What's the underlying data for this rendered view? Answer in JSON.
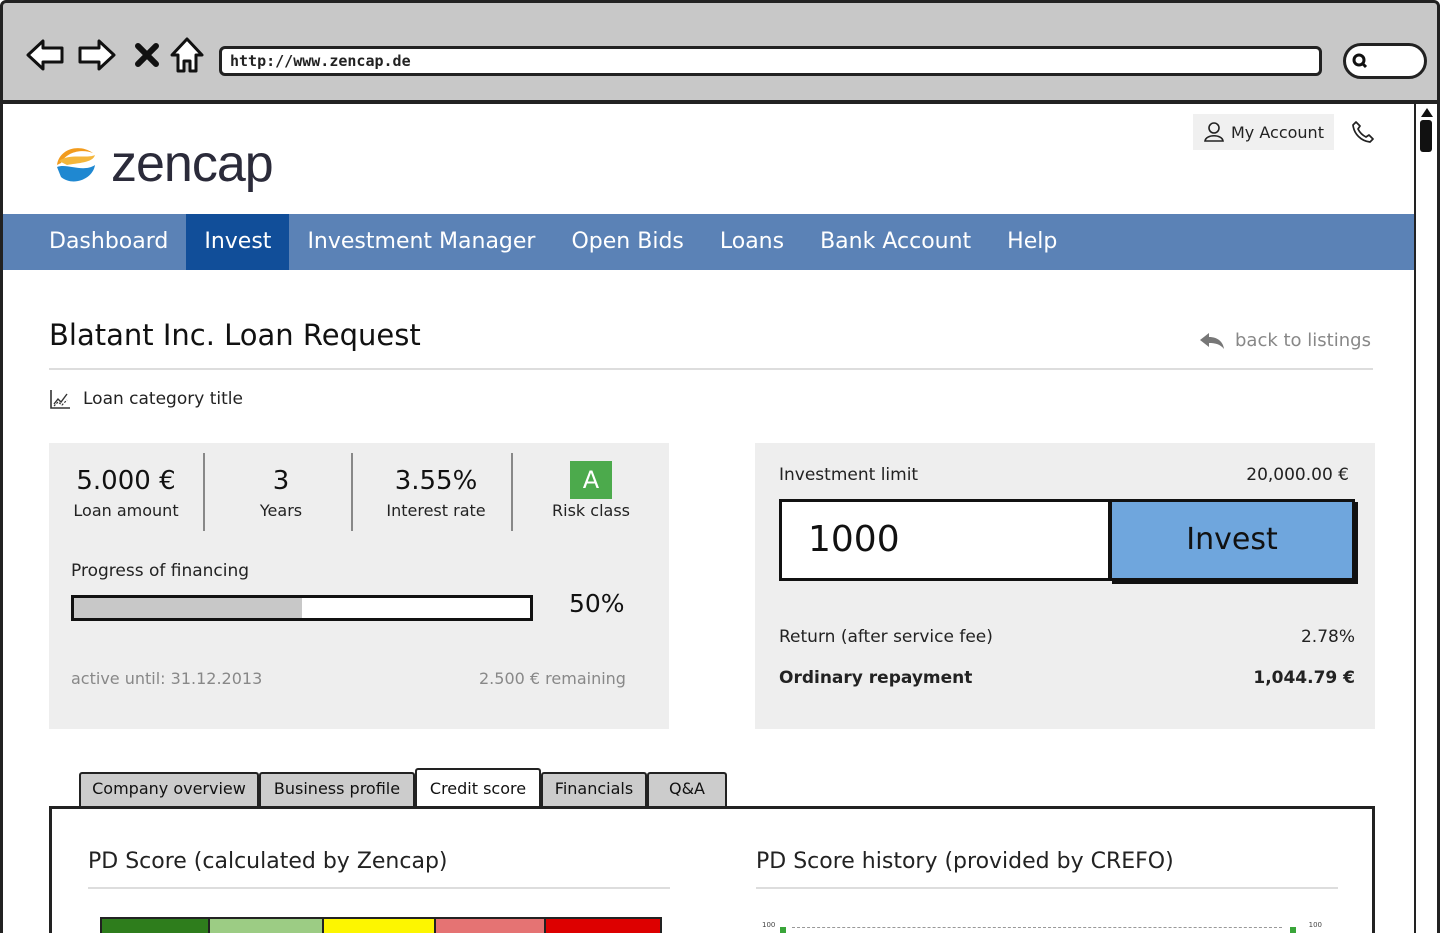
{
  "browser": {
    "url": "http://www.zencap.de"
  },
  "header": {
    "brand": "zencap",
    "account_label": "My Account"
  },
  "nav": [
    {
      "label": "Dashboard",
      "active": false
    },
    {
      "label": "Invest",
      "active": true
    },
    {
      "label": "Investment Manager",
      "active": false
    },
    {
      "label": "Open Bids",
      "active": false
    },
    {
      "label": "Loans",
      "active": false
    },
    {
      "label": "Bank Account",
      "active": false
    },
    {
      "label": "Help",
      "active": false
    }
  ],
  "page": {
    "title": "Blatant Inc. Loan Request",
    "back_label": "back to listings",
    "category": "Loan category title"
  },
  "loan": {
    "amount": {
      "value": "5.000 €",
      "label": "Loan amount"
    },
    "term": {
      "value": "3",
      "label": "Years"
    },
    "rate": {
      "value": "3.55%",
      "label": "Interest rate"
    },
    "risk": {
      "value": "A",
      "label": "Risk class"
    },
    "progress_label": "Progress of financing",
    "progress": 0.5,
    "progress_text": "50%",
    "active_until": "active until: 31.12.2013",
    "remaining": "2.500 € remaining"
  },
  "investment": {
    "limit_label": "Investment limit",
    "limit_value": "20,000.00 €",
    "amount_value": "1000",
    "invest_label": "Invest",
    "return_label": "Return (after service fee)",
    "return_value": "2.78%",
    "repayment_label": "Ordinary repayment",
    "repayment_value": "1,044.79 €"
  },
  "tabs": [
    "Company overview",
    "Business profile",
    "Credit score",
    "Financials",
    "Q&A"
  ],
  "active_tab": "Credit score",
  "credit": {
    "pd_title": "PD Score (calculated by Zencap)",
    "history_title": "PD Score history (provided by CREFO)",
    "pd_colors": [
      "#2e7d1c",
      "#9ccc84",
      "#fdf600",
      "#e57373",
      "#dd0000"
    ],
    "history_y_top_left": "100",
    "history_y_top_right": "100"
  }
}
